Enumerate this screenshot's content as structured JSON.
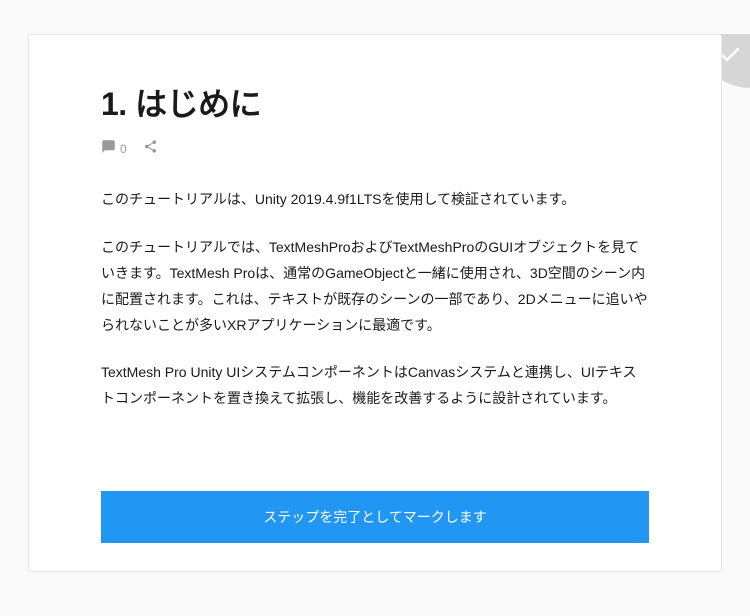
{
  "header": {
    "title": "1. はじめに",
    "comment_count": "0"
  },
  "content": {
    "paragraphs": [
      "このチュートリアルは、Unity 2019.4.9f1LTSを使用して検証されています。",
      "このチュートリアルでは、TextMeshProおよびTextMeshProのGUIオブジェクトを見ていきます。TextMesh Proは、通常のGameObjectと一緒に使用され、3D空間のシーン内に配置されます。これは、テキストが既存のシーンの一部であり、2Dメニューに追いやられないことが多いXRアプリケーションに最適です。",
      "TextMesh Pro Unity UIシステムコンポーネントはCanvasシステムと連携し、UIテキストコンポーネントを置き換えて拡張し、機能を改善するように設計されています。"
    ]
  },
  "actions": {
    "complete_label": "ステップを完了としてマークします"
  }
}
